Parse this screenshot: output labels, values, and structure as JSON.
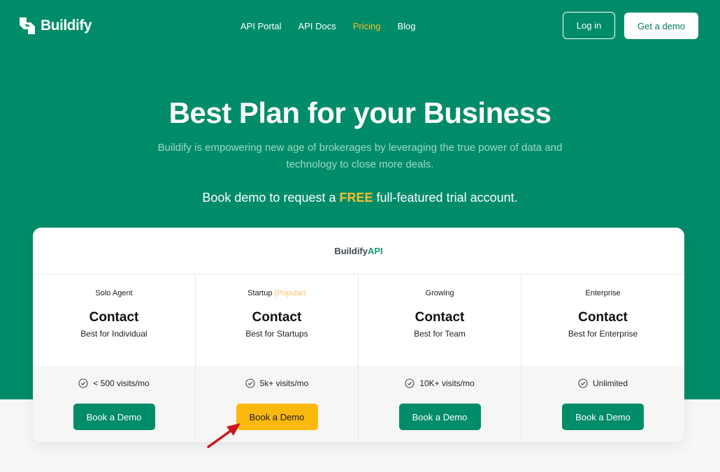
{
  "brand": {
    "name": "Buildify"
  },
  "nav": {
    "items": [
      {
        "label": "API Portal",
        "active": false
      },
      {
        "label": "API Docs",
        "active": false
      },
      {
        "label": "Pricing",
        "active": true
      },
      {
        "label": "Blog",
        "active": false
      }
    ],
    "login_label": "Log in",
    "demo_label": "Get a demo"
  },
  "hero": {
    "title": "Best Plan for your Business",
    "subtitle": "Buildify is empowering new age of brokerages by leveraging the true power of data and technology to close more deals.",
    "cta_before": "Book demo to request a ",
    "cta_highlight": "FREE",
    "cta_after": " full-featured trial account."
  },
  "card": {
    "brand_prefix": "Buildify",
    "brand_suffix": "API"
  },
  "plans": [
    {
      "name": "Solo Agent",
      "tag": "",
      "price": "Contact",
      "desc": "Best for Individual",
      "feature": "< 500 visits/mo",
      "button": "Book a Demo",
      "featured": false
    },
    {
      "name": "Startup",
      "tag": "(Popular)",
      "price": "Contact",
      "desc": "Best for Startups",
      "feature": "5k+ visits/mo",
      "button": "Book a Demo",
      "featured": true
    },
    {
      "name": "Growing",
      "tag": "",
      "price": "Contact",
      "desc": "Best for Team",
      "feature": "10K+ visits/mo",
      "button": "Book a Demo",
      "featured": false
    },
    {
      "name": "Enterprise",
      "tag": "",
      "price": "Contact",
      "desc": "Best for Enterprise",
      "feature": "Unlimited",
      "button": "Book a Demo",
      "featured": false
    }
  ],
  "colors": {
    "brand_green": "#008c68",
    "accent_yellow": "#f5bf2a",
    "featured_button": "#fbb80f",
    "annotation_arrow": "#c8161d"
  },
  "icons": {
    "logo": "buildify-logo-icon",
    "feature": "check-circle-icon",
    "annotation": "red-arrow-icon"
  }
}
